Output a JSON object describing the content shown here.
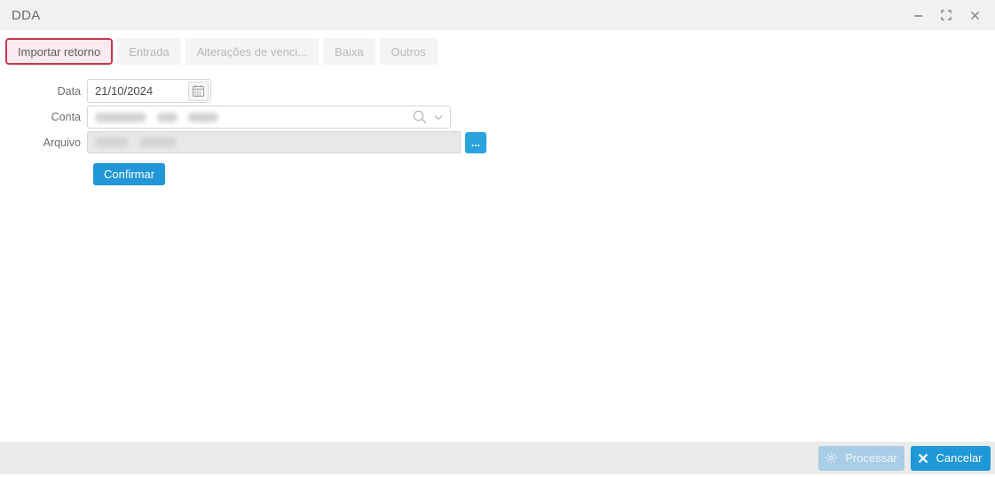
{
  "window": {
    "title": "DDA"
  },
  "tabs": [
    {
      "label": "Importar retorno",
      "active": true
    },
    {
      "label": "Entrada",
      "active": false
    },
    {
      "label": "Alterações de venci...",
      "active": false
    },
    {
      "label": "Baixa",
      "active": false
    },
    {
      "label": "Outros",
      "active": false
    }
  ],
  "form": {
    "data_label": "Data",
    "data_value": "21/10/2024",
    "conta_label": "Conta",
    "conta_value_redacted": true,
    "arquivo_label": "Arquivo",
    "arquivo_value_redacted": true,
    "browse_label": "...",
    "confirm_label": "Confirmar"
  },
  "footer": {
    "process_label": "Processar",
    "cancel_label": "Cancelar"
  },
  "icons": {
    "titlebar": [
      "minimize-icon",
      "maximize-icon",
      "close-icon"
    ],
    "date_field": "calendar-icon",
    "conta_field": [
      "search-icon",
      "chevron-down-icon"
    ],
    "process_button": "gear-icon",
    "cancel_button": "x-icon"
  },
  "colors": {
    "accent_blue": "#2196d8",
    "disabled_blue": "#a9cde7",
    "active_tab_border": "#c9364c",
    "active_tab_bg": "#fbebee",
    "titlebar_bg": "#f2f1f1",
    "footer_bg": "#ebebeb"
  }
}
